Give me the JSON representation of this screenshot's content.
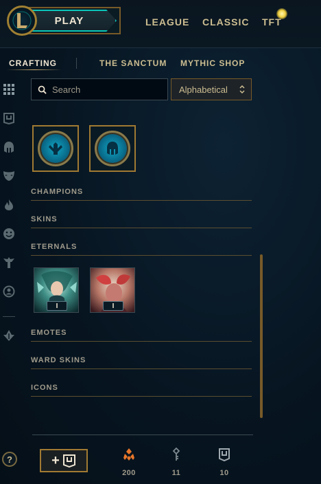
{
  "header": {
    "play_label": "PLAY",
    "nav": [
      "LEAGUE",
      "CLASSIC",
      "TFT"
    ]
  },
  "subtabs": [
    "CRAFTING",
    "THE SANCTUM",
    "MYTHIC SHOP"
  ],
  "search": {
    "placeholder": "Search",
    "value": ""
  },
  "sort": {
    "selected": "Alphabetical"
  },
  "sections": {
    "champions": "CHAMPIONS",
    "skins": "SKINS",
    "eternals": "ETERNALS",
    "emotes": "EMOTES",
    "ward_skins": "WARD SKINS",
    "icons": "ICONS"
  },
  "eternal_items": [
    {
      "badge": "I"
    },
    {
      "badge": "I"
    }
  ],
  "help_label": "?",
  "add_label": "+",
  "currencies": [
    {
      "icon": "orange-essence-icon",
      "value": "200"
    },
    {
      "icon": "key-icon",
      "value": "11"
    },
    {
      "icon": "chest-icon",
      "value": "10"
    }
  ],
  "colors": {
    "gold": "#c8aa6e",
    "teal": "#0ac8b9",
    "orange_essence": "#e8762a",
    "background": "#071521"
  }
}
